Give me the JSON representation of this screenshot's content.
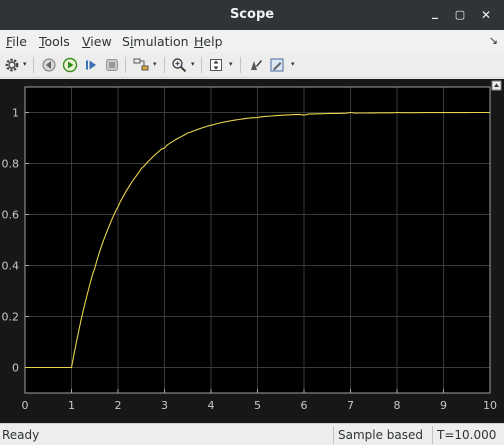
{
  "window": {
    "title": "Scope",
    "minimize_glyph": "_",
    "maximize_glyph": "▢",
    "close_glyph": "✕"
  },
  "menubar": {
    "items": [
      {
        "label": "File",
        "mnemonic": "F",
        "rest": "ile"
      },
      {
        "label": "Tools",
        "mnemonic": "T",
        "rest": "ools"
      },
      {
        "label": "View",
        "mnemonic": "V",
        "rest": "iew"
      },
      {
        "label": "Simulation",
        "pre": "S",
        "mnemonic": "i",
        "rest": "mulation"
      },
      {
        "label": "Help",
        "mnemonic": "H",
        "rest": "elp"
      }
    ],
    "dock_arrow": "↘"
  },
  "toolbar": {
    "icons": [
      "gear-icon",
      "step-back-icon",
      "run-icon",
      "step-forward-icon",
      "stop-icon",
      "highlight-icon",
      "zoom-icon",
      "autoscale-icon",
      "write-data-icon",
      "style-icon"
    ]
  },
  "chart_data": {
    "type": "line",
    "title": "",
    "xlabel": "",
    "ylabel": "",
    "xlim": [
      0,
      10
    ],
    "ylim": [
      -0.1,
      1.1
    ],
    "xticks": [
      "0",
      "1",
      "2",
      "3",
      "4",
      "5",
      "6",
      "7",
      "8",
      "9",
      "10"
    ],
    "yticks": [
      "0",
      "0.2",
      "0.4",
      "0.6",
      "0.8",
      "1"
    ],
    "grid": true,
    "series": [
      {
        "color": "#e8d44d",
        "x": [
          0,
          1,
          1.5,
          2,
          2.5,
          3,
          3.5,
          4,
          5,
          6,
          7,
          8,
          9,
          10
        ],
        "y": [
          0,
          0,
          0.39,
          0.63,
          0.78,
          0.86,
          0.92,
          0.95,
          0.98,
          0.99,
          1,
          1,
          1,
          1
        ]
      }
    ]
  },
  "status": {
    "text": "Ready",
    "mode": "Sample based",
    "time": "T=10.000"
  }
}
